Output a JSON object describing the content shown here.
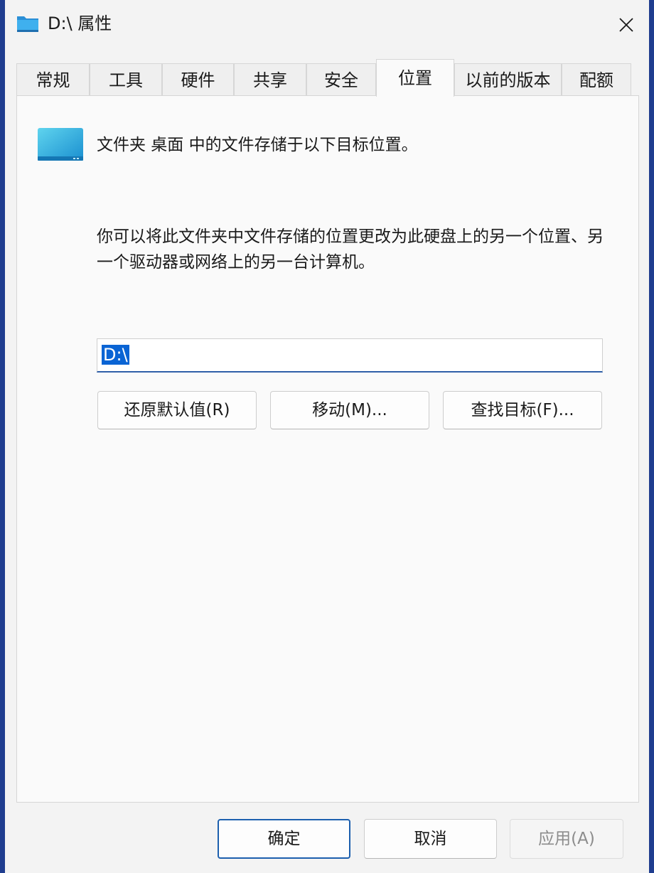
{
  "window": {
    "title": "D:\\ 属性",
    "icons": {
      "title": "drive-folder-icon",
      "close": "close-icon",
      "folder": "folder-icon"
    },
    "colors": {
      "accent": "#0a64d4",
      "primary_border": "#1c5fae"
    }
  },
  "tabs": [
    {
      "label": "常规"
    },
    {
      "label": "工具"
    },
    {
      "label": "硬件"
    },
    {
      "label": "共享"
    },
    {
      "label": "安全"
    },
    {
      "label": "位置",
      "active": true
    },
    {
      "label": "以前的版本"
    },
    {
      "label": "配额"
    }
  ],
  "location": {
    "heading": "文件夹 桌面 中的文件存储于以下目标位置。",
    "description": "你可以将此文件夹中文件存储的位置更改为此硬盘上的另一个位置、另一个驱动器或网络上的另一台计算机。",
    "path_value": "D:\\",
    "buttons": {
      "restore": "还原默认值(R)",
      "move": "移动(M)...",
      "find_target": "查找目标(F)..."
    }
  },
  "footer": {
    "ok": "确定",
    "cancel": "取消",
    "apply": "应用(A)"
  }
}
